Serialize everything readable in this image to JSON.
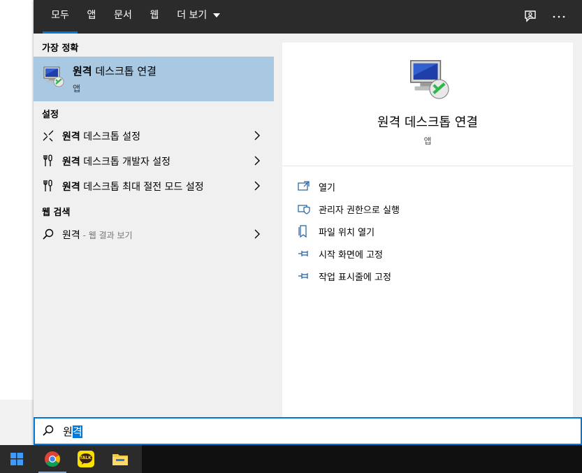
{
  "tabs": [
    {
      "label": "모두",
      "active": true
    },
    {
      "label": "앱",
      "active": false
    },
    {
      "label": "문서",
      "active": false
    },
    {
      "label": "웹",
      "active": false
    },
    {
      "label": "더 보기",
      "active": false
    }
  ],
  "top_icons": [
    "feedback-icon",
    "more-options-icon"
  ],
  "best_match": {
    "heading": "가장 정확",
    "title": "원격 데스크톱 연결",
    "title_bold": "원격",
    "title_rest": " 데스크톱 연결",
    "subtitle": "앱",
    "icon": "remote-desktop-icon"
  },
  "settings": {
    "heading": "설정",
    "items": [
      {
        "bold": "원격",
        "rest": " 데스크톱 설정",
        "icon": "remote-settings-icon"
      },
      {
        "bold": "원격",
        "rest": " 데스크톱 개발자 설정",
        "icon": "developer-tools-icon"
      },
      {
        "bold": "원격",
        "rest": " 데스크톱 최대 절전 모드 설정",
        "icon": "developer-tools-icon"
      }
    ]
  },
  "web": {
    "heading": "웹 검색",
    "item": {
      "bold": "원격",
      "hint": " - 웹 결과 보기",
      "icon": "search-icon"
    }
  },
  "preview": {
    "title": "원격 데스크톱 연결",
    "type": "앱",
    "actions": [
      {
        "label": "열기",
        "icon": "open-icon"
      },
      {
        "label": "관리자 권한으로 실행",
        "icon": "run-as-admin-icon"
      },
      {
        "label": "파일 위치 열기",
        "icon": "file-location-icon"
      },
      {
        "label": "시작 화면에 고정",
        "icon": "pin-start-icon"
      },
      {
        "label": "작업 표시줄에 고정",
        "icon": "pin-taskbar-icon"
      }
    ]
  },
  "search": {
    "typed": "원",
    "selected": "격",
    "icon": "search-icon"
  },
  "taskbar": {
    "items": [
      "windows-start-icon",
      "chrome-icon",
      "kakaotalk-icon",
      "file-explorer-icon"
    ],
    "kakao_label": "TALK"
  },
  "colors": {
    "accent": "#0078d7",
    "highlight": "#a9c8e1",
    "topbar": "#2b2b2b"
  }
}
